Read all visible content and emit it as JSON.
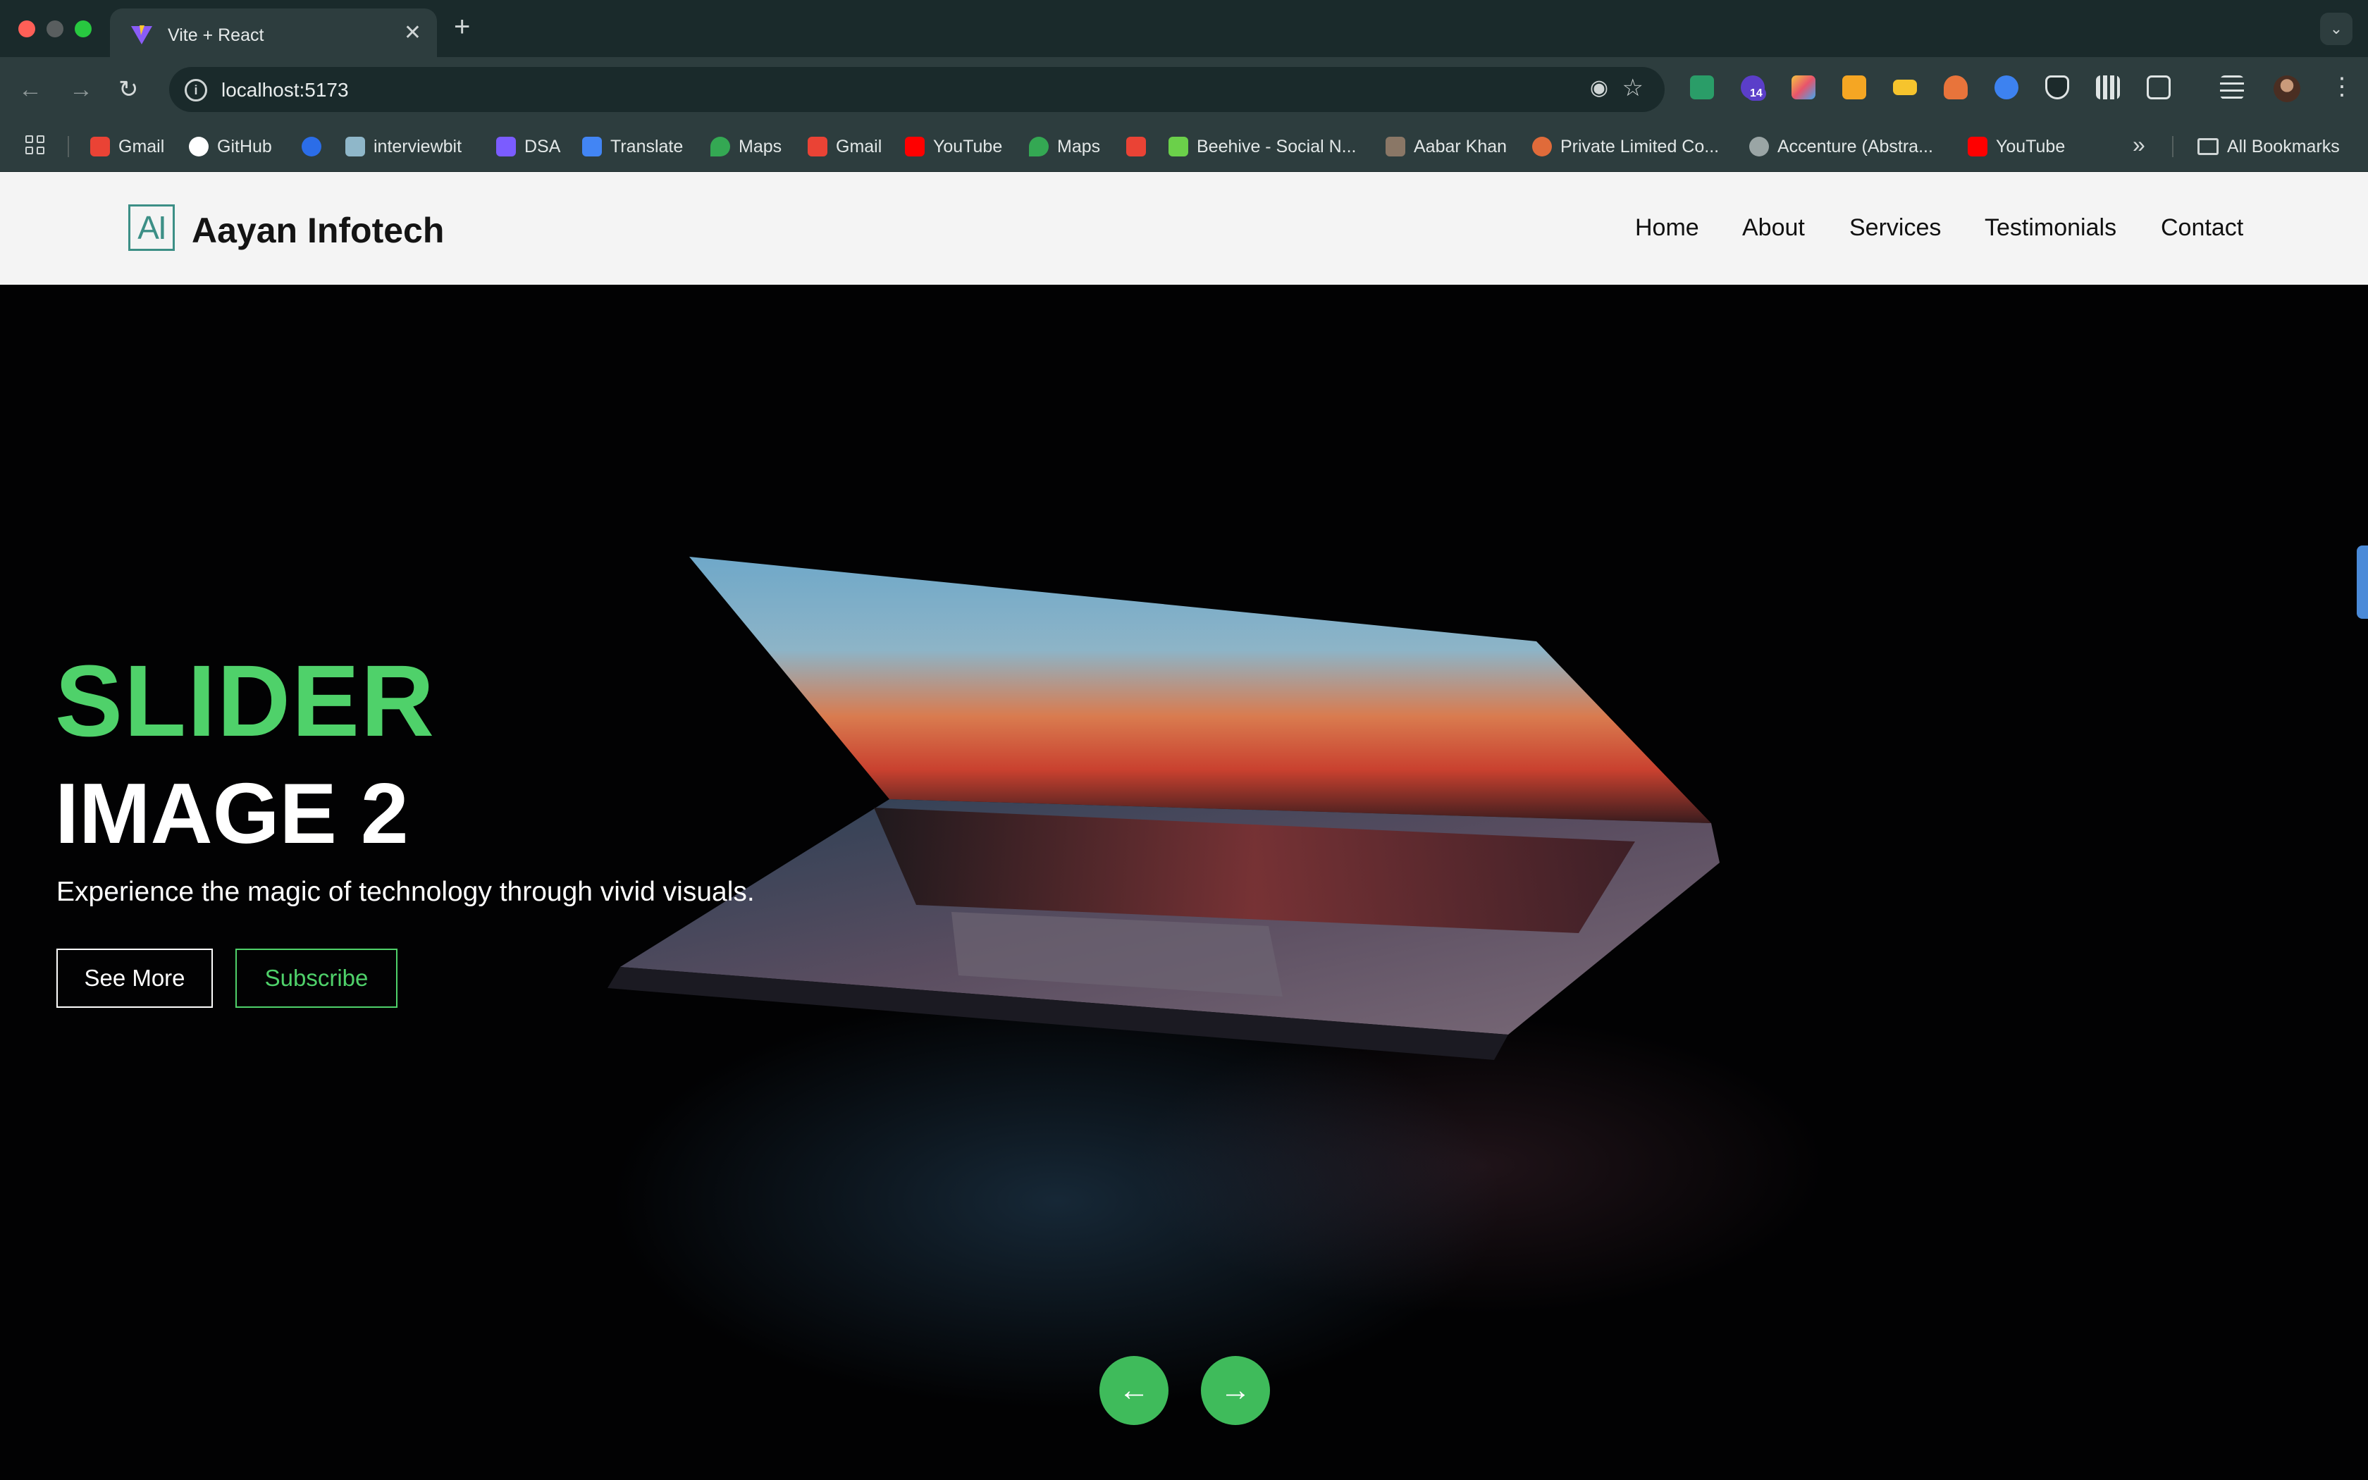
{
  "browser": {
    "tab_title": "Vite + React",
    "url": "localhost:5173",
    "extension_badge": "14",
    "bookmarks": [
      {
        "label": "Gmail",
        "icon": "gmail-icon",
        "color": "#ea4335"
      },
      {
        "label": "GitHub",
        "icon": "github-icon",
        "color": "#ffffff"
      },
      {
        "label": "",
        "icon": "c-icon",
        "color": "#2b6de8"
      },
      {
        "label": "interviewbit",
        "icon": "interviewbit-icon",
        "color": "#8fb7c9"
      },
      {
        "label": "DSA",
        "icon": "dsa-icon",
        "color": "#7b5cff"
      },
      {
        "label": "Translate",
        "icon": "translate-icon",
        "color": "#4285f4"
      },
      {
        "label": "Maps",
        "icon": "maps-icon",
        "color": "#34a853"
      },
      {
        "label": "Gmail",
        "icon": "gmail-icon",
        "color": "#ea4335"
      },
      {
        "label": "YouTube",
        "icon": "youtube-icon",
        "color": "#ff0000"
      },
      {
        "label": "Maps",
        "icon": "maps-icon",
        "color": "#34a853"
      },
      {
        "label": "",
        "icon": "gmail-icon",
        "color": "#ea4335"
      },
      {
        "label": "Beehive - Social N...",
        "icon": "beehive-icon",
        "color": "#6bd04a"
      },
      {
        "label": "Aabar Khan",
        "icon": "profile-icon",
        "color": "#8a7766"
      },
      {
        "label": "Private Limited Co...",
        "icon": "company-icon",
        "color": "#e06b3a"
      },
      {
        "label": "Accenture (Abstra...",
        "icon": "globe-icon",
        "color": "#9aa5a5"
      },
      {
        "label": "YouTube",
        "icon": "youtube-icon",
        "color": "#ff0000"
      }
    ],
    "all_bookmarks": "All Bookmarks"
  },
  "site": {
    "brand": "Aayan Infotech",
    "logo_text": "AI",
    "nav": [
      "Home",
      "About",
      "Services",
      "Testimonials",
      "Contact"
    ],
    "colors": {
      "accent": "#4fd16a",
      "arrow_bg": "#3fbb5b",
      "logo": "#3c8f86"
    }
  },
  "hero": {
    "title_line1": "SLIDER",
    "title_line2": "IMAGE 2",
    "subtitle": "Experience the magic of technology through vivid visuals.",
    "primary_button": "See More",
    "secondary_button": "Subscribe",
    "prev_icon": "arrow-left-icon",
    "next_icon": "arrow-right-icon"
  }
}
